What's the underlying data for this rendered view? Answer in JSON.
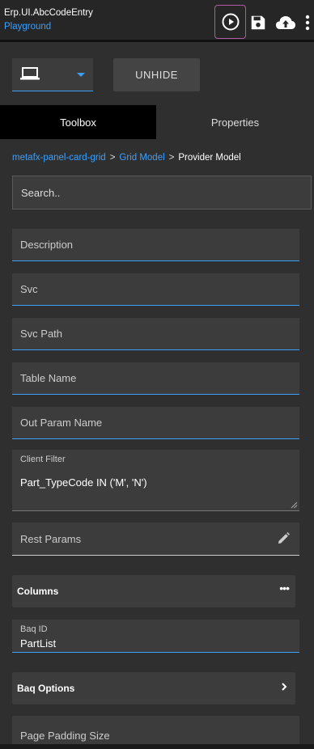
{
  "header": {
    "title": "Erp.UI.AbcCodeEntry",
    "subtitle": "Playground",
    "icons": [
      "play-circle-icon",
      "save-icon",
      "cloud-upload-icon",
      "more-vertical-icon"
    ]
  },
  "toolbar": {
    "device_icon": "laptop-icon",
    "unhide_label": "UNHIDE"
  },
  "tabs": [
    {
      "label": "Toolbox",
      "active": true
    },
    {
      "label": "Properties",
      "active": false
    }
  ],
  "breadcrumb": {
    "items": [
      "metafx-panel-card-grid",
      "Grid Model"
    ],
    "current": "Provider Model",
    "separator": ">"
  },
  "search": {
    "placeholder": "Search.."
  },
  "fields": {
    "description": "Description",
    "svc": "Svc",
    "svc_path": "Svc Path",
    "table_name": "Table Name",
    "out_param_name": "Out Param Name",
    "client_filter_label": "Client Filter",
    "client_filter_value": "Part_TypeCode IN ('M', 'N')",
    "rest_params": "Rest Params",
    "baq_id_label": "Baq ID",
    "baq_id_value": "PartList",
    "page_padding_size": "Page Padding Size"
  },
  "sections": {
    "columns": "Columns",
    "columns_more": "•••",
    "baq_options": "Baq Options"
  },
  "colors": {
    "accent": "#3aa0ff",
    "background": "#2f2f2f",
    "field_bg": "#3c3c3c",
    "play_border": "#b05aa6"
  }
}
